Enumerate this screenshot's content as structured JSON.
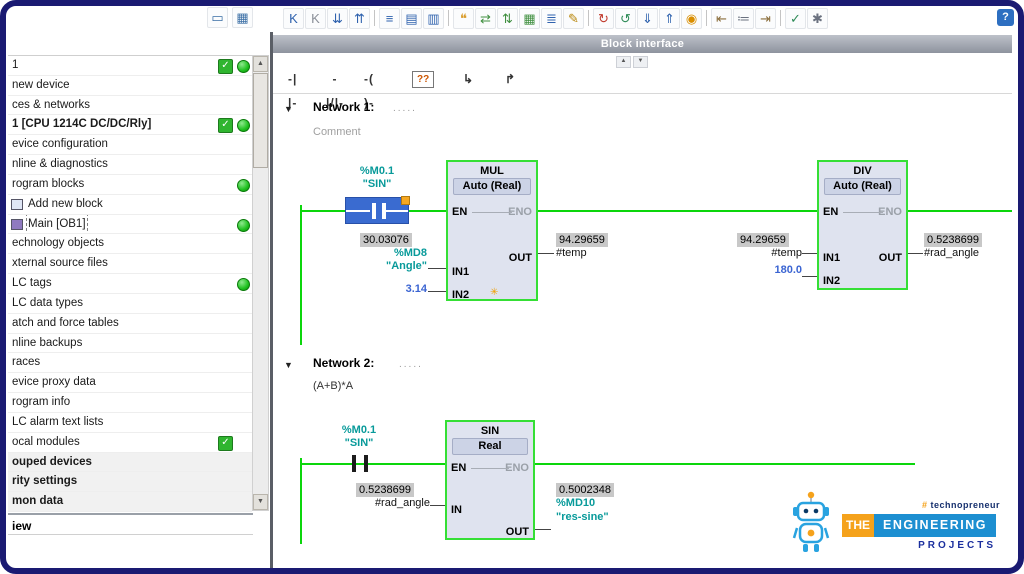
{
  "theme": {
    "frame": "#1a1a72",
    "green": "#0cd60c",
    "teal": "#089a9a",
    "constBlue": "#3a64d2",
    "monitorBg": "#c8c8c8",
    "blockBg": "#dfe3ef",
    "blockBorder": "#35df35",
    "selBlue": "#3a6bd0",
    "selBorder": "#2850a8",
    "dotGreen": "#1fc11f",
    "checkGreen": "#2fb52f",
    "barTop": "#bdc1c9",
    "barBottom": "#8e939e",
    "logoOrange": "#f5a21b",
    "logoBlue": "#1d8fd1",
    "logoNavy": "#1b2f9e"
  },
  "toolbar": {
    "left": [
      {
        "name": "overview-window-icon",
        "glyph": "▭",
        "color": "#3a6ea5"
      },
      {
        "name": "split-editor-icon",
        "glyph": "▦",
        "color": "#3a6ea5"
      }
    ],
    "main": [
      {
        "name": "keep-actual-values-icon",
        "glyph": "K",
        "color": "#2f62ae"
      },
      {
        "name": "snapshot-values-icon",
        "glyph": "K",
        "color": "#8a8f98"
      },
      {
        "name": "copy-snapshots-icon",
        "glyph": "⇊",
        "color": "#2f62ae"
      },
      {
        "name": "load-start-values-icon",
        "glyph": "⇈",
        "color": "#2f62ae"
      },
      {
        "sep": true
      },
      {
        "name": "expand-networks-icon",
        "glyph": "≡",
        "color": "#2f62ae"
      },
      {
        "name": "collapse-networks-icon",
        "glyph": "▤",
        "color": "#2f62ae"
      },
      {
        "name": "network-table-icon",
        "glyph": "▥",
        "color": "#2f62ae"
      },
      {
        "sep": true
      },
      {
        "name": "network-comments-icon",
        "glyph": "❝",
        "color": "#d99c2b"
      },
      {
        "name": "absolute-operands-icon",
        "glyph": "⇄",
        "color": "#3f8f3f"
      },
      {
        "name": "symbolic-operands-icon",
        "glyph": "⇅",
        "color": "#3f8f3f"
      },
      {
        "name": "tag-information-icon",
        "glyph": "▦",
        "color": "#3f8f3f"
      },
      {
        "name": "favorites-icon",
        "glyph": "≣",
        "color": "#2f62ae"
      },
      {
        "name": "free-comments-icon",
        "glyph": "✎",
        "color": "#b8860b"
      },
      {
        "sep": true
      },
      {
        "name": "go-online-icon",
        "glyph": "↻",
        "color": "#c0392b"
      },
      {
        "name": "go-offline-icon",
        "glyph": "↺",
        "color": "#2e8b57"
      },
      {
        "name": "download-icon",
        "glyph": "⇓",
        "color": "#2f62ae"
      },
      {
        "name": "upload-icon",
        "glyph": "⇑",
        "color": "#2f62ae"
      },
      {
        "name": "monitoring-icon",
        "glyph": "◉",
        "color": "#d98e00"
      },
      {
        "sep": true
      },
      {
        "name": "jump-backward-icon",
        "glyph": "⇤",
        "color": "#8a6d3b"
      },
      {
        "name": "call-environment-icon",
        "glyph": "≔",
        "color": "#6b7280"
      },
      {
        "name": "jump-forward-icon",
        "glyph": "⇥",
        "color": "#8a6d3b"
      },
      {
        "sep": true
      },
      {
        "name": "syntax-check-icon",
        "glyph": "✓",
        "color": "#2e8b57"
      },
      {
        "name": "compile-icon",
        "glyph": "✱",
        "color": "#6b7280"
      }
    ],
    "help_glyph": "?"
  },
  "panel": {
    "check_glyph": "✓",
    "scroll_up": "▲",
    "scroll_down": "▼",
    "details_label": "iew",
    "items": [
      {
        "label": "1",
        "check": true,
        "dot": true
      },
      {
        "label": "new device"
      },
      {
        "label": "ces & networks"
      },
      {
        "label": "1 [CPU 1214C DC/DC/Rly]",
        "bold": true,
        "check": true,
        "dot": true
      },
      {
        "label": "evice configuration"
      },
      {
        "label": "nline & diagnostics"
      },
      {
        "label": "rogram blocks",
        "dot": true
      },
      {
        "label": "Add new block",
        "icon": "add-block"
      },
      {
        "label": "Main [OB1]",
        "dot": true,
        "selected": true,
        "icon": "ob-block"
      },
      {
        "label": "echnology objects"
      },
      {
        "label": "xternal source files"
      },
      {
        "label": "LC tags",
        "dot": true
      },
      {
        "label": "LC data types"
      },
      {
        "label": "atch and force tables"
      },
      {
        "label": "nline backups"
      },
      {
        "label": "races"
      },
      {
        "label": "evice proxy data"
      },
      {
        "label": "rogram info"
      },
      {
        "label": "LC alarm text lists"
      },
      {
        "label": "ocal modules",
        "check": true
      },
      {
        "label": "ouped devices",
        "bold": true,
        "shaded": true
      },
      {
        "label": "rity settings",
        "bold": true,
        "shaded": true
      },
      {
        "label": "mon data",
        "bold": true,
        "shaded": true
      }
    ]
  },
  "editor": {
    "interface_bar": "Block interface",
    "split_up": "▲",
    "split_down": "▼",
    "lad_buttons": [
      {
        "name": "contact-no-button",
        "label": "-| |-"
      },
      {
        "name": "contact-nc-button",
        "label": "-|/|-"
      },
      {
        "name": "coil-button",
        "label": "-( )-"
      },
      {
        "name": "empty-box-button",
        "label": "??",
        "boxed": true
      },
      {
        "name": "open-branch-button",
        "label": "↳"
      },
      {
        "name": "close-branch-button",
        "label": "↱"
      }
    ],
    "net1": {
      "collapse_glyph": "▼",
      "title": "Network 1:",
      "dots": ".....",
      "comment": "Comment",
      "spark": "✳",
      "contact": {
        "addr": "%M0.1",
        "name": "\"SIN\""
      },
      "mul": {
        "title": "MUL",
        "type": "Auto (Real)",
        "en": "EN",
        "eno": "ENO",
        "in1": "IN1",
        "in2": "IN2",
        "out": "OUT"
      },
      "mul_in1": {
        "value": "30.03076",
        "addr": "%MD8",
        "name": "\"Angle\""
      },
      "mul_in2": {
        "value": "3.14"
      },
      "mul_out": {
        "value": "94.29659",
        "name": "#temp"
      },
      "div": {
        "title": "DIV",
        "type": "Auto (Real)",
        "en": "EN",
        "eno": "ENO",
        "in1": "IN1",
        "in2": "IN2",
        "out": "OUT"
      },
      "div_in1": {
        "value": "94.29659",
        "name": "#temp"
      },
      "div_in2": {
        "value": "180.0"
      },
      "div_out": {
        "value": "0.5238699",
        "name": "#rad_angle"
      }
    },
    "net2": {
      "collapse_glyph": "▼",
      "title": "Network 2:",
      "dots": ".....",
      "comment": "(A+B)*A",
      "contact": {
        "addr": "%M0.1",
        "name": "\"SIN\""
      },
      "sin": {
        "title": "SIN",
        "type": "Real",
        "en": "EN",
        "eno": "ENO",
        "in": "IN",
        "out": "OUT"
      },
      "sin_in": {
        "value": "0.5238699",
        "name": "#rad_angle"
      },
      "sin_out": {
        "value": "0.5002348",
        "addr": "%MD10",
        "name": "\"res-sine\""
      }
    }
  },
  "logo": {
    "hash": "#",
    "tagline": "technopreneur",
    "line1": "THE",
    "line2": "ENGINEERING",
    "line3": "PROJECTS"
  }
}
